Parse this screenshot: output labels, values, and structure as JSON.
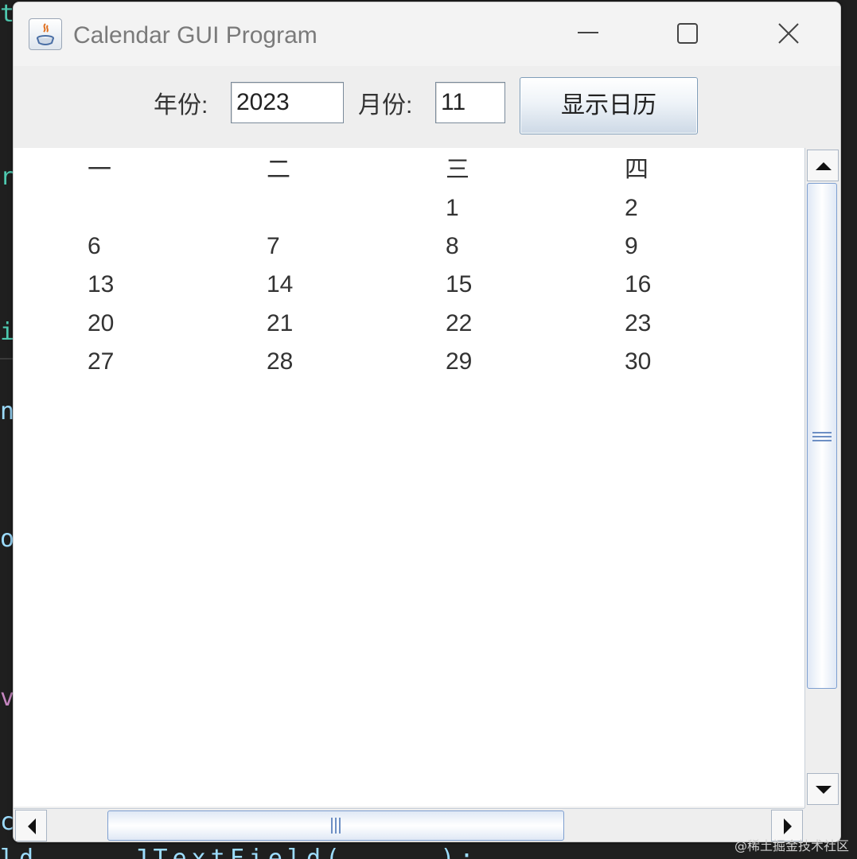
{
  "window": {
    "title": "Calendar GUI Program"
  },
  "toolbar": {
    "year_label": "年份:",
    "year_value": "2023",
    "month_label": "月份:",
    "month_value": "11",
    "show_button": "显示日历"
  },
  "calendar": {
    "headers": [
      "一",
      "二",
      "三",
      "四"
    ],
    "rows": [
      [
        "",
        "",
        "1",
        "2"
      ],
      [
        "6",
        "7",
        "8",
        "9"
      ],
      [
        "13",
        "14",
        "15",
        "16"
      ],
      [
        "20",
        "21",
        "22",
        "23"
      ],
      [
        "27",
        "28",
        "29",
        "30"
      ]
    ]
  },
  "watermark": "@稀土掘金技术社区",
  "colors": {
    "accent": "#7e9fd0",
    "window_bg": "#f0f0f0",
    "content_bg": "#ffffff"
  }
}
